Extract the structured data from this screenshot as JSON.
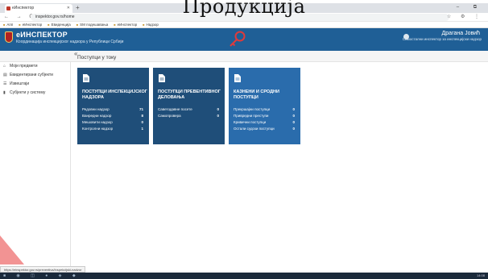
{
  "slide_title": "Продукција",
  "browser": {
    "tab_title": "eИнспектор",
    "new_tab": "+",
    "window_controls": "– ⧉",
    "nav": "← → C",
    "url": "inspektor.gov.rs/home",
    "addr_icons": "☆ ⚙ ⋮",
    "bookmarks": [
      "Апп",
      "eИнспектор",
      "Евиденција",
      "SM подешавања",
      "eИнспектор",
      "Надзор"
    ]
  },
  "header": {
    "brand": "еИНСПЕКТОР",
    "subtitle": "Координација инспекцијског надзора у Републици Србији",
    "user_name": "Драгана Јовић",
    "user_role": "Самостални инспектор за инспекцијски надзор"
  },
  "breadcrumb": {
    "collapse": "«",
    "label": "Поступци у току"
  },
  "sidebar": {
    "items": [
      {
        "icon": "⌂",
        "label": "Моји предмети"
      },
      {
        "icon": "▤",
        "label": "Евидентирани субјекти"
      },
      {
        "icon": "☰",
        "label": "Извештаји"
      },
      {
        "icon": "▮",
        "label": "Субјекти у систему"
      }
    ]
  },
  "cards": [
    {
      "title": "ПОСТУПЦИ ИНСПЕКЦИЈСКОГ НАДЗОРА",
      "rows": [
        {
          "label": "Редовни надзор",
          "value": "71"
        },
        {
          "label": "Ванредни надзор",
          "value": "8"
        },
        {
          "label": "Мешовити надзор",
          "value": "0"
        },
        {
          "label": "Контролни надзор",
          "value": "1"
        }
      ]
    },
    {
      "title": "ПОСТУПЦИ ПРЕВЕНТИВНОГ ДЕЛОВАЊА",
      "rows": [
        {
          "label": "Саветодавне посете",
          "value": "0"
        },
        {
          "label": "Самопровера",
          "value": "0"
        }
      ]
    },
    {
      "title": "КАЗНЕНИ И СРОДНИ ПОСТУПЦИ",
      "rows": [
        {
          "label": "Прекршајни поступци",
          "value": "0"
        },
        {
          "label": "Привредни преступи",
          "value": "0"
        },
        {
          "label": "Кривични поступци",
          "value": "0"
        },
        {
          "label": "Остали судски поступци",
          "value": "0"
        }
      ]
    }
  ],
  "statusbar": "https://einspektor.gov.rs/preventiva/inspekcijski-nadzor",
  "taskbar": {
    "icons": "■ ◉ ◫ ● ◈ ◆",
    "clock": "14:08"
  },
  "colors": {
    "header": "#1f5f96",
    "card_dark": "#1f4e79",
    "card_light": "#2a6cac"
  }
}
